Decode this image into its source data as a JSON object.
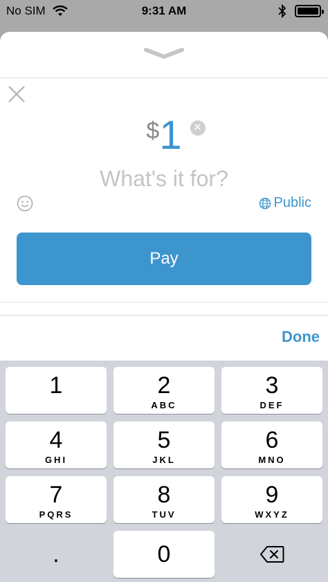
{
  "status_bar": {
    "carrier": "No SIM",
    "time": "9:31 AM"
  },
  "payment": {
    "currency_symbol": "$",
    "amount": "1",
    "note_placeholder": "What's it for?",
    "privacy_label": "Public",
    "pay_label": "Pay",
    "done_label": "Done"
  },
  "keypad": {
    "keys": [
      {
        "digit": "1",
        "letters": ""
      },
      {
        "digit": "2",
        "letters": "ABC"
      },
      {
        "digit": "3",
        "letters": "DEF"
      },
      {
        "digit": "4",
        "letters": "GHI"
      },
      {
        "digit": "5",
        "letters": "JKL"
      },
      {
        "digit": "6",
        "letters": "MNO"
      },
      {
        "digit": "7",
        "letters": "PQRS"
      },
      {
        "digit": "8",
        "letters": "TUV"
      },
      {
        "digit": "9",
        "letters": "WXYZ"
      }
    ],
    "decimal": ".",
    "zero": "0"
  },
  "colors": {
    "accent": "#3d95ce",
    "keyboard_bg": "#d1d4da",
    "status_bar_bg": "#a9a9a9"
  },
  "icons": [
    "wifi-icon",
    "bluetooth-icon",
    "battery-icon",
    "chevron-down-icon",
    "close-icon",
    "clear-icon",
    "emoji-icon",
    "globe-icon",
    "backspace-icon"
  ]
}
